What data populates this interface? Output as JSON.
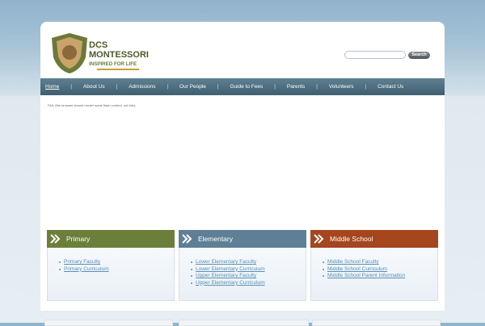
{
  "brand": {
    "name_line1": "DCS",
    "name_line2": "MONTESSORI",
    "tagline": "INSPIRED FOR LIFE"
  },
  "search": {
    "placeholder": "",
    "value": "",
    "button_label": "Search"
  },
  "nav": {
    "items": [
      "Home",
      "About Us",
      "Admissions",
      "Our People",
      "Guide to Fees",
      "Parents",
      "Volunteers",
      "Contact Us"
    ],
    "separator": "|"
  },
  "flash_message": "FAIL (the browser should render some flash content, not this).",
  "boxes": [
    {
      "title": "Primary",
      "color": "#6b7f3a",
      "links": [
        "Primary Faculty",
        "Primary Curriculum"
      ]
    },
    {
      "title": "Elementary",
      "color": "#5e7f95",
      "links": [
        "Lower Elementary Faculty",
        "Lower Elementary Curriculum",
        "Upper Elementary Faculty",
        "Upper Elementary Curriculum"
      ]
    },
    {
      "title": "Middle School",
      "color": "#a5461d",
      "links": [
        "Middle School Faculty",
        "Middle School Curriculum",
        "Middle School Parent Information"
      ]
    }
  ],
  "colors": {
    "nav": "#4f6f80",
    "link": "#5a8fb4",
    "logo_green": "#6b7a37",
    "logo_gold": "#c7a233"
  }
}
